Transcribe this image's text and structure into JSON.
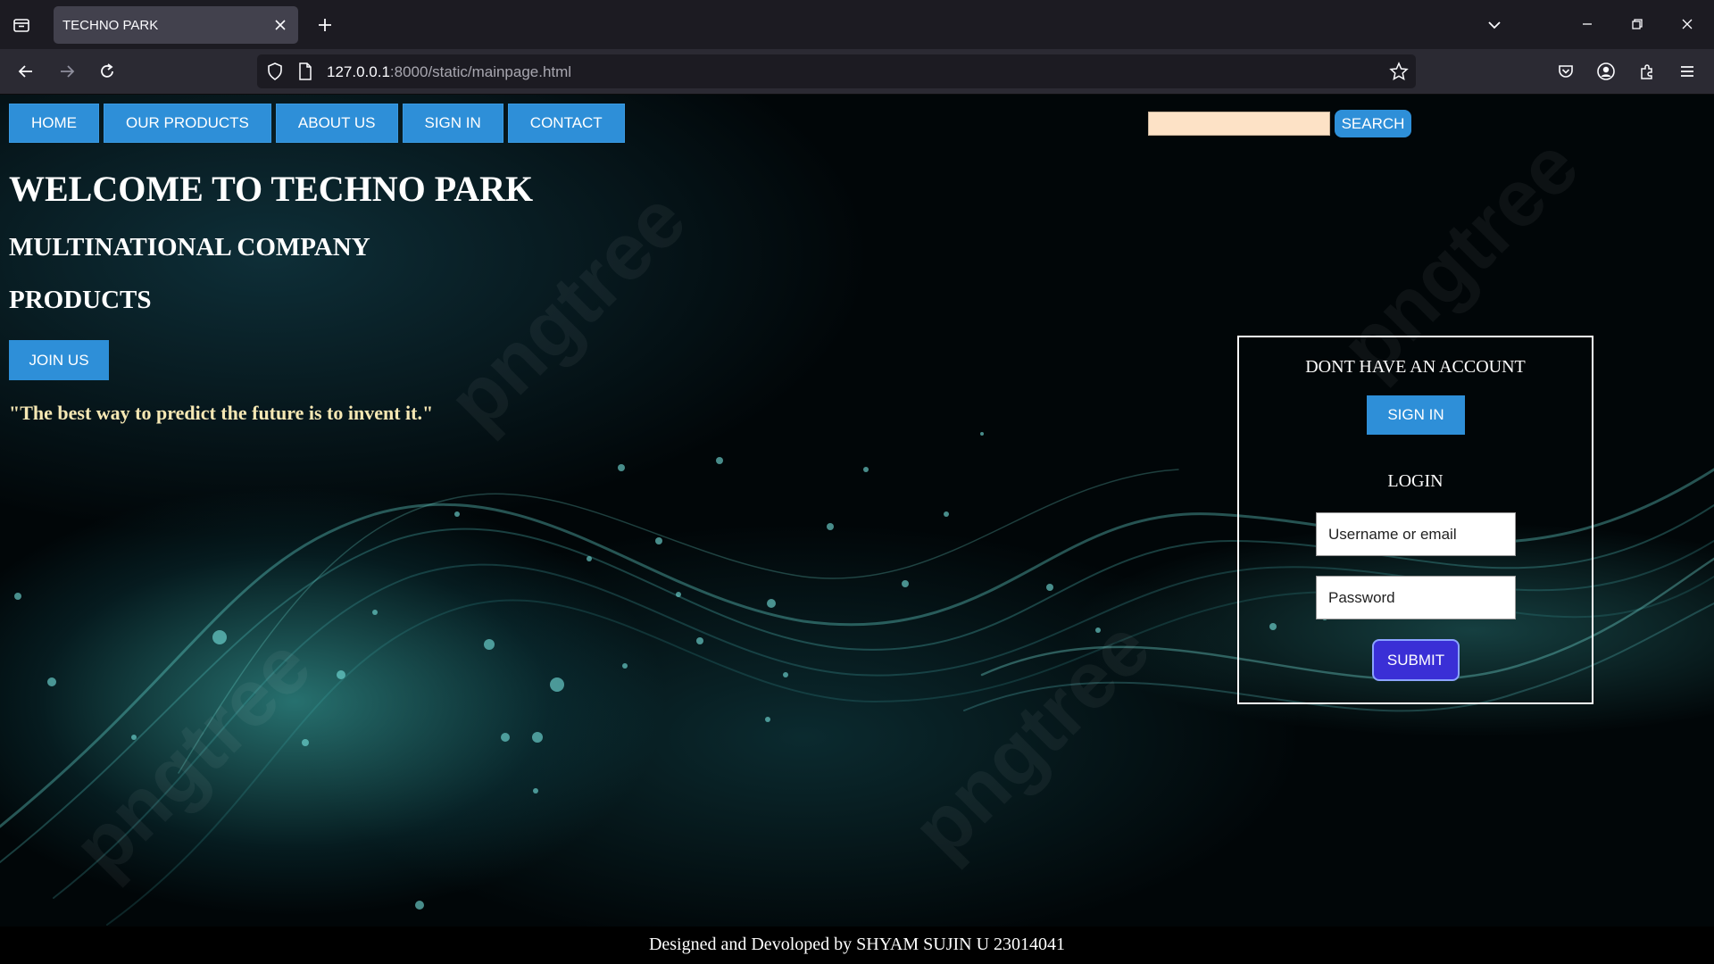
{
  "browser": {
    "tab_title": "TECHNO PARK",
    "url_host": "127.0.0.1",
    "url_rest": ":8000/static/mainpage.html"
  },
  "site_nav": {
    "items": [
      "HOME",
      "OUR PRODUCTS",
      "ABOUT US",
      "SIGN IN",
      "CONTACT"
    ]
  },
  "search": {
    "value": "",
    "button_label": "SEARCH"
  },
  "hero": {
    "title": "WELCOME TO TECHNO PARK",
    "subtitle": "MULTINATIONAL COMPANY",
    "products_heading": "PRODUCTS",
    "join_label": "JOIN US",
    "quote": "\"The best way to predict the future is to invent it.\""
  },
  "login_box": {
    "no_account_text": "DONT HAVE AN ACCOUNT",
    "signin_label": "SIGN IN",
    "login_heading": "LOGIN",
    "username_placeholder": "Username or email",
    "password_placeholder": "Password",
    "submit_label": "SUBMIT"
  },
  "footer": {
    "text": "Designed and Devoloped by SHYAM SUJIN U 23014041"
  },
  "colors": {
    "nav_button": "#2e8fd8",
    "submit_button": "#3a2fd6",
    "search_field": "#fde2c6",
    "quote_text": "#f6e8b4",
    "chrome_bg": "#1c1b22"
  }
}
